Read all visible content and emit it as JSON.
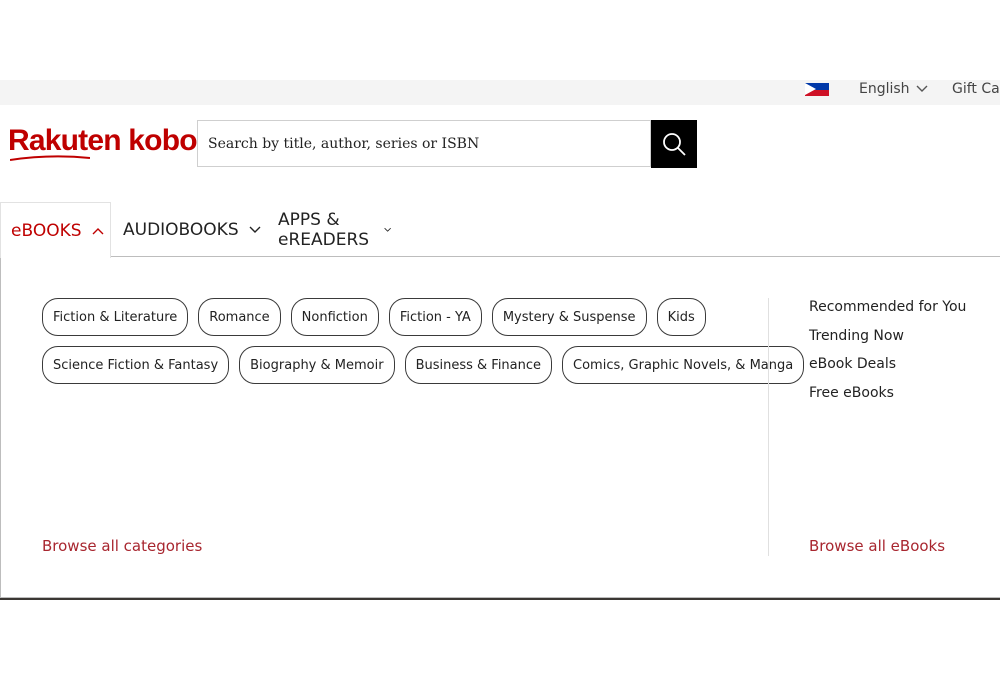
{
  "topbar": {
    "flag_icon": "philippines-flag",
    "language": "English",
    "gift_card": "Gift Car"
  },
  "logo": {
    "text": "Rakuten kobo",
    "color": "#bf0000"
  },
  "search": {
    "placeholder": "Search by title, author, series or ISBN",
    "button_icon": "search-icon"
  },
  "nav": {
    "tabs": [
      {
        "label": "eBOOKS",
        "active": true
      },
      {
        "label": "AUDIOBOOKS",
        "active": false
      },
      {
        "label": "APPS & eREADERS",
        "active": false
      }
    ]
  },
  "menu": {
    "categories_row1": [
      "Fiction & Literature",
      "Romance",
      "Nonfiction",
      "Fiction - YA",
      "Mystery & Suspense",
      "Kids"
    ],
    "categories_row2": [
      "Science Fiction & Fantasy",
      "Biography & Memoir",
      "Business & Finance",
      "Comics, Graphic Novels, & Manga"
    ],
    "quick_links": [
      "Recommended for You",
      "Trending Now",
      "eBook Deals",
      "Free eBooks"
    ],
    "browse_categories": "Browse all categories",
    "browse_ebooks": "Browse all eBooks",
    "accent_color": "#a8262f"
  }
}
